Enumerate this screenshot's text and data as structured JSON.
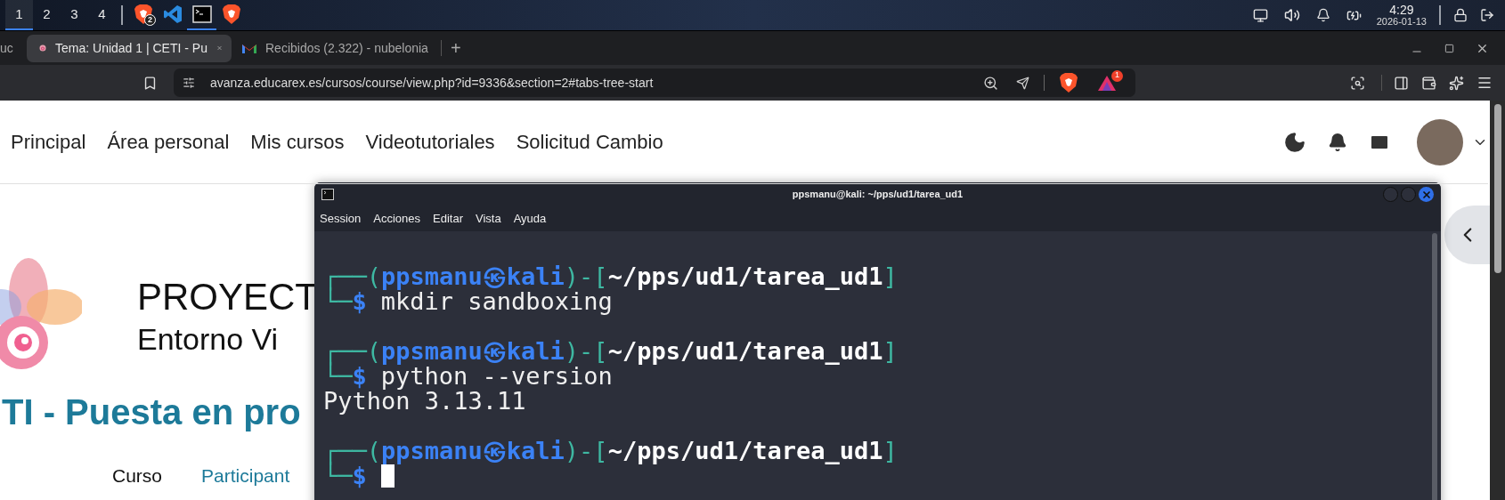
{
  "taskbar": {
    "workspaces": [
      {
        "label": "1",
        "selected": true
      },
      {
        "label": "2",
        "selected": false
      },
      {
        "label": "3",
        "selected": false
      },
      {
        "label": "4",
        "selected": false
      }
    ],
    "apps": [
      {
        "kind": "brave",
        "badge": "2",
        "selected": false
      },
      {
        "kind": "vscode",
        "selected": false
      },
      {
        "kind": "terminal",
        "selected": true
      },
      {
        "kind": "brave",
        "selected": false
      }
    ],
    "time": "4:29",
    "date": "2026-01-13"
  },
  "browser": {
    "tabs": [
      {
        "label": "uc",
        "kind": "partial",
        "selected": false
      },
      {
        "label": "Tema: Unidad 1 | CETI - Pu",
        "kind": "moodle",
        "selected": true
      },
      {
        "label": "Recibidos (2.322) - nubelonia",
        "kind": "gmail",
        "selected": false
      }
    ],
    "new_tab": "+",
    "url": "avanza.educarex.es/cursos/course/view.php?id=9336&section=2#tabs-tree-start",
    "rewards_badge": "1"
  },
  "page": {
    "nav": [
      {
        "label": "Principal"
      },
      {
        "label": "Área personal"
      },
      {
        "label": "Mis cursos"
      },
      {
        "label": "Videotutoriales"
      },
      {
        "label": "Solicitud Cambio"
      }
    ],
    "logo_title": "PROYECT",
    "logo_subtitle": "Entorno Vi",
    "course_title": "TI - Puesta en pro",
    "course_tabs": [
      {
        "label": "Curso",
        "selected": true
      },
      {
        "label": "Participant",
        "selected": false
      }
    ]
  },
  "terminal": {
    "title": "ppsmanu@kali: ~/pps/ud1/tarea_ud1",
    "menu": [
      "Session",
      "Acciones",
      "Editar",
      "Vista",
      "Ayuda"
    ],
    "blocks": [
      {
        "open": "┌──(",
        "user": "ppsmanu",
        "at": "㉿",
        "host": "kali",
        "mid": ")-[",
        "path": "~/pps/ud1/tarea_ud1",
        "close": "]",
        "corner": "└─",
        "dollar": "$",
        "command": "mkdir sandboxing",
        "cursor": false
      },
      {
        "open": "┌──(",
        "user": "ppsmanu",
        "at": "㉿",
        "host": "kali",
        "mid": ")-[",
        "path": "~/pps/ud1/tarea_ud1",
        "close": "]",
        "corner": "└─",
        "dollar": "$",
        "command": "python --version",
        "output": "Python 3.13.11",
        "cursor": false
      },
      {
        "open": "┌──(",
        "user": "ppsmanu",
        "at": "㉿",
        "host": "kali",
        "mid": ")-[",
        "path": "~/pps/ud1/tarea_ud1",
        "close": "]",
        "corner": "└─",
        "dollar": "$",
        "cursor": true
      }
    ]
  }
}
